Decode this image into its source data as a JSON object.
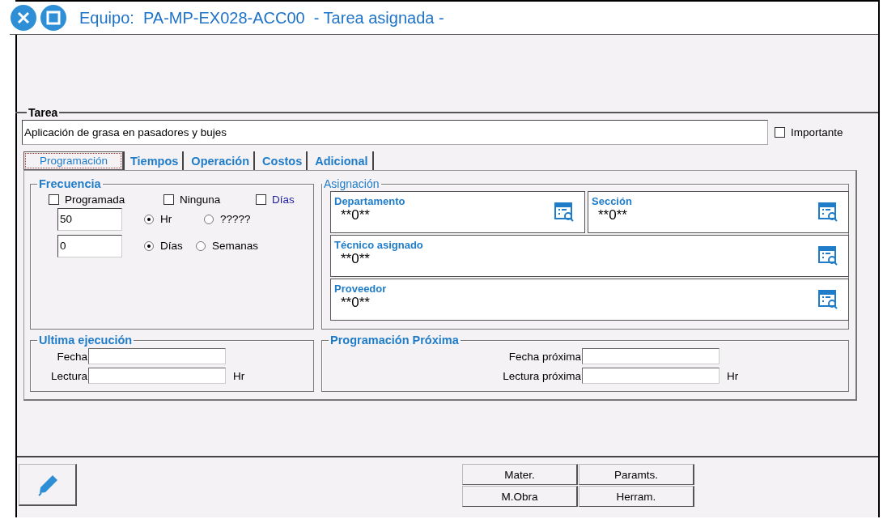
{
  "window": {
    "title_prefix": "Equipo:",
    "equipment": "PA-MP-EX028-ACC00",
    "title_suffix": "- Tarea asignada -"
  },
  "tarea": {
    "legend": "Tarea",
    "description": "Aplicación de grasa en pasadores y bujes",
    "important": {
      "label": "Importante",
      "checked": false
    }
  },
  "tabs": [
    {
      "label": "Programación",
      "selected": true
    },
    {
      "label": "Tiempos",
      "selected": false
    },
    {
      "label": "Operación",
      "selected": false
    },
    {
      "label": "Costos",
      "selected": false
    },
    {
      "label": "Adicional",
      "selected": false
    }
  ],
  "frecuencia": {
    "legend": "Frecuencia",
    "checks": [
      {
        "label": "Programada",
        "checked": false,
        "color": "#000000"
      },
      {
        "label": "Ninguna",
        "checked": false,
        "color": "#000000"
      },
      {
        "label": "Días",
        "checked": false,
        "color": "#1c1ca0"
      }
    ],
    "rows": [
      {
        "value": "50",
        "options": [
          {
            "label": "Hr",
            "selected": true
          },
          {
            "label": "?????",
            "selected": false
          }
        ]
      },
      {
        "value": "0",
        "options": [
          {
            "label": "Días",
            "selected": true
          },
          {
            "label": "Semanas",
            "selected": false
          }
        ]
      }
    ]
  },
  "asignacion": {
    "legend": "Asignación",
    "fields": [
      {
        "label": "Departamento",
        "value": "**0**",
        "wide": false
      },
      {
        "label": "Sección",
        "value": "**0**",
        "wide": false
      },
      {
        "label": "Técnico asignado",
        "value": "**0**",
        "wide": true
      },
      {
        "label": "Proveedor",
        "value": "**0**",
        "wide": true
      }
    ]
  },
  "ultima_ejecucion": {
    "legend": "Ultima ejecución",
    "fields": [
      {
        "label": "Fecha"
      },
      {
        "label": "Lectura",
        "unit": "Hr"
      }
    ]
  },
  "programacion_proxima": {
    "legend": "Programación Próxima",
    "fields": [
      {
        "label": "Fecha próxima"
      },
      {
        "label": "Lectura próxima",
        "unit": "Hr"
      }
    ]
  },
  "buttons": [
    {
      "label": "Mater."
    },
    {
      "label": "Paramts."
    },
    {
      "label": "M.Obra"
    },
    {
      "label": "Herram."
    }
  ]
}
